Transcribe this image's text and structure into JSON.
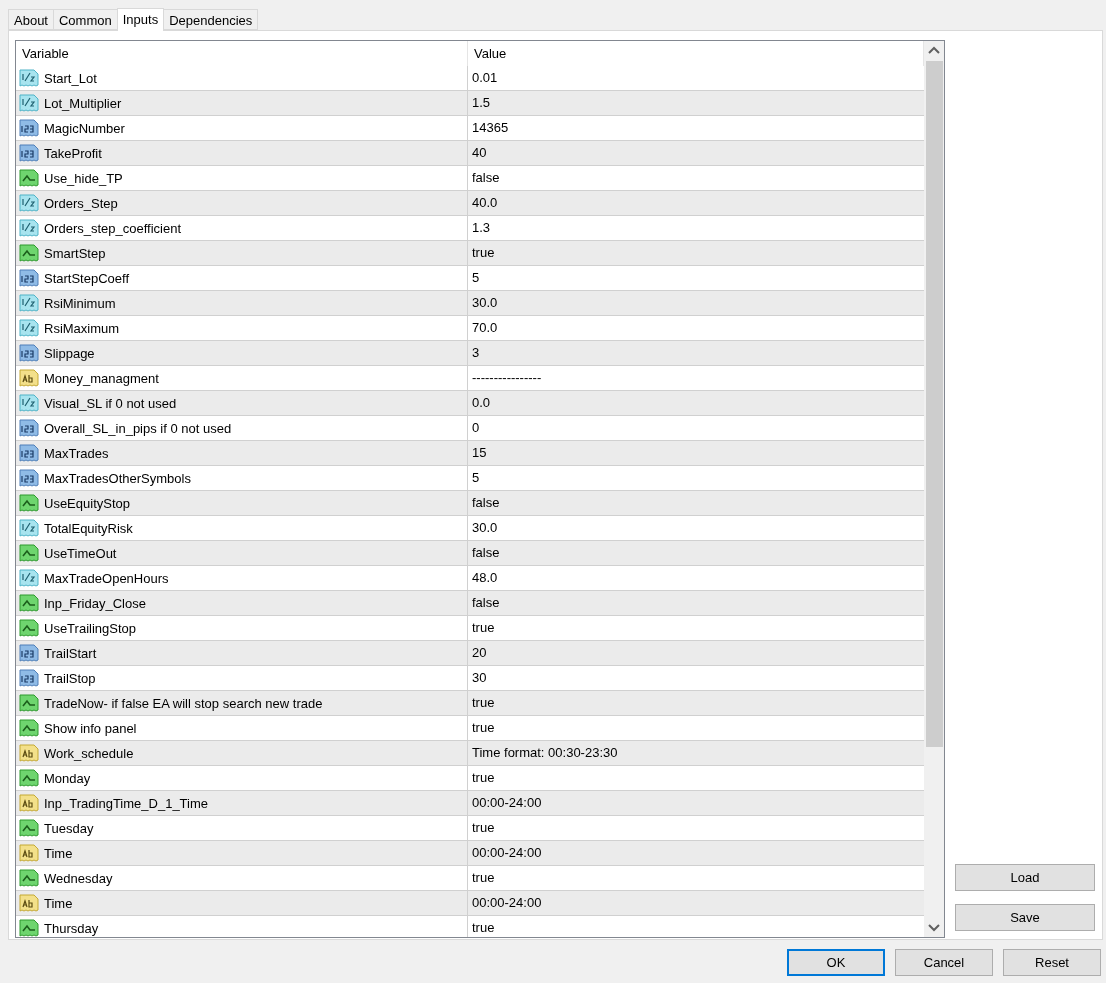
{
  "tabs": [
    {
      "label": "About",
      "selected": false
    },
    {
      "label": "Common",
      "selected": false
    },
    {
      "label": "Inputs",
      "selected": true
    },
    {
      "label": "Dependencies",
      "selected": false
    }
  ],
  "table": {
    "columns": [
      "Variable",
      "Value"
    ],
    "rows": [
      {
        "kind": "double",
        "name": "Start_Lot",
        "value": "0.01"
      },
      {
        "kind": "double",
        "name": "Lot_Multiplier",
        "value": "1.5"
      },
      {
        "kind": "int",
        "name": "MagicNumber",
        "value": "14365"
      },
      {
        "kind": "int",
        "name": "TakeProfit",
        "value": "40"
      },
      {
        "kind": "bool",
        "name": "Use_hide_TP",
        "value": "false"
      },
      {
        "kind": "double",
        "name": "Orders_Step",
        "value": "40.0"
      },
      {
        "kind": "double",
        "name": "Orders_step_coefficient",
        "value": "1.3"
      },
      {
        "kind": "bool",
        "name": "SmartStep",
        "value": "true"
      },
      {
        "kind": "int",
        "name": "StartStepCoeff",
        "value": "5"
      },
      {
        "kind": "double",
        "name": "RsiMinimum",
        "value": "30.0"
      },
      {
        "kind": "double",
        "name": "RsiMaximum",
        "value": "70.0"
      },
      {
        "kind": "int",
        "name": "Slippage",
        "value": "3"
      },
      {
        "kind": "string",
        "name": "Money_managment",
        "value": "----------------"
      },
      {
        "kind": "double",
        "name": "Visual_SL if 0 not used",
        "value": "0.0"
      },
      {
        "kind": "int",
        "name": "Overall_SL_in_pips if 0 not used",
        "value": "0"
      },
      {
        "kind": "int",
        "name": "MaxTrades",
        "value": "15"
      },
      {
        "kind": "int",
        "name": "MaxTradesOtherSymbols",
        "value": "5"
      },
      {
        "kind": "bool",
        "name": "UseEquityStop",
        "value": "false"
      },
      {
        "kind": "double",
        "name": "TotalEquityRisk",
        "value": "30.0"
      },
      {
        "kind": "bool",
        "name": "UseTimeOut",
        "value": "false"
      },
      {
        "kind": "double",
        "name": "MaxTradeOpenHours",
        "value": "48.0"
      },
      {
        "kind": "bool",
        "name": "Inp_Friday_Close",
        "value": "false"
      },
      {
        "kind": "bool",
        "name": "UseTrailingStop",
        "value": "true"
      },
      {
        "kind": "int",
        "name": "TrailStart",
        "value": "20"
      },
      {
        "kind": "int",
        "name": "TrailStop",
        "value": "30"
      },
      {
        "kind": "bool",
        "name": "TradeNow- if false EA will stop search new trade",
        "value": "true"
      },
      {
        "kind": "bool",
        "name": "Show info panel",
        "value": "true"
      },
      {
        "kind": "string",
        "name": "Work_schedule",
        "value": "Time format: 00:30-23:30"
      },
      {
        "kind": "bool",
        "name": "Monday",
        "value": "true"
      },
      {
        "kind": "string",
        "name": "Inp_TradingTime_D_1_Time",
        "value": "00:00-24:00"
      },
      {
        "kind": "bool",
        "name": "Tuesday",
        "value": "true"
      },
      {
        "kind": "string",
        "name": "Time",
        "value": "00:00-24:00"
      },
      {
        "kind": "bool",
        "name": "Wednesday",
        "value": "true"
      },
      {
        "kind": "string",
        "name": "Time",
        "value": "00:00-24:00"
      },
      {
        "kind": "bool",
        "name": "Thursday",
        "value": "true"
      }
    ]
  },
  "side_buttons": [
    "Load",
    "Save"
  ],
  "footer_buttons": [
    {
      "label": "OK",
      "default": true
    },
    {
      "label": "Cancel",
      "default": false
    },
    {
      "label": "Reset",
      "default": false
    }
  ]
}
